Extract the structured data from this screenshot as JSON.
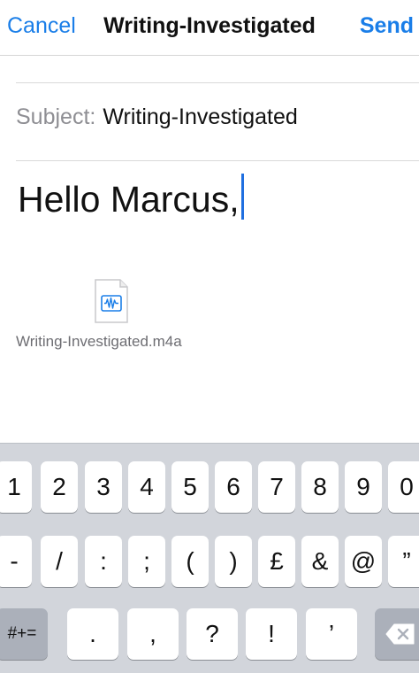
{
  "nav": {
    "cancel_label": "Cancel",
    "title": "Writing-Investigated",
    "send_label": "Send"
  },
  "subject": {
    "label": "Subject:",
    "value": "Writing-Investigated"
  },
  "body": {
    "text": "Hello Marcus,"
  },
  "attachment": {
    "icon": "audio-file-icon",
    "filename": "Writing-Investigated.m4a"
  },
  "keyboard": {
    "row1": [
      "1",
      "2",
      "3",
      "4",
      "5",
      "6",
      "7",
      "8",
      "9",
      "0"
    ],
    "row2": [
      "-",
      "/",
      ":",
      ";",
      "(",
      ")",
      "£",
      "&",
      "@",
      "”"
    ],
    "row3": [
      "#+=",
      ".",
      ",",
      "?",
      "!",
      "’"
    ],
    "backspace_icon": "backspace-icon"
  }
}
